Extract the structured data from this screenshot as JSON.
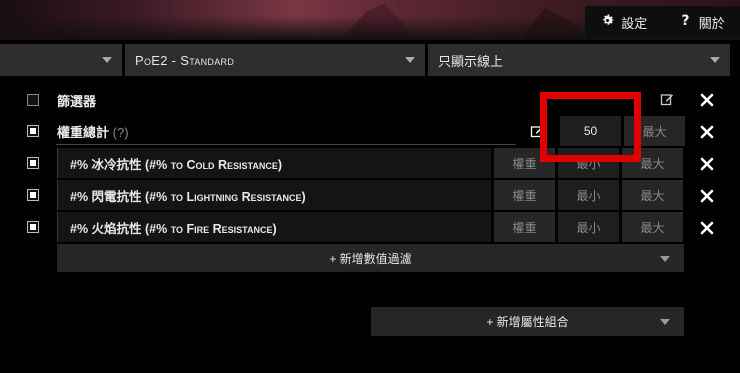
{
  "header": {
    "settings_label": "設定",
    "about_label": "關於",
    "settings_icon": "gear-icon",
    "about_icon": "question-icon"
  },
  "filter_bar": {
    "left_dropdown": "",
    "league": "PoE2 - Standard",
    "online_filter": "只顯示線上"
  },
  "filters": {
    "label": "篩選器",
    "checked": false
  },
  "weight_sum": {
    "label": "權重總計",
    "help": "(?)",
    "checked": true,
    "min_value": "50",
    "max_placeholder": "最大"
  },
  "stat_rows": [
    {
      "checked": true,
      "name": "#% 冰冷抗性 (#% to Cold Resistance)",
      "weight_placeholder": "權重",
      "min_placeholder": "最小",
      "max_placeholder": "最大"
    },
    {
      "checked": true,
      "name": "#% 閃電抗性 (#% to Lightning Resistance)",
      "weight_placeholder": "權重",
      "min_placeholder": "最小",
      "max_placeholder": "最大"
    },
    {
      "checked": true,
      "name": "#% 火焰抗性 (#% to Fire Resistance)",
      "weight_placeholder": "權重",
      "min_placeholder": "最小",
      "max_placeholder": "最大"
    }
  ],
  "buttons": {
    "add_stat_filter": "+ 新增數值過濾",
    "add_property_group": "+ 新增屬性組合"
  },
  "colors": {
    "highlight": "#e10000",
    "panel": "#262626"
  }
}
